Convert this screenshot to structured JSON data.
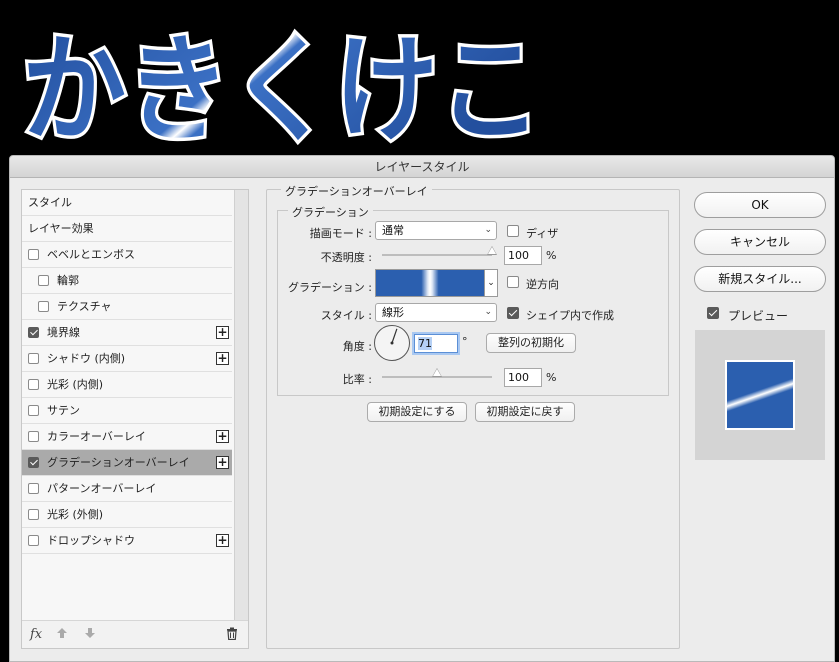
{
  "banner": {
    "text": "かきくけこ"
  },
  "dialog": {
    "title": "レイヤースタイル",
    "styles_header": "スタイル",
    "layer_effects": "レイヤー効果",
    "items": [
      {
        "label": "ベベルとエンボス",
        "checked": false,
        "plus": false
      },
      {
        "label": "輪郭",
        "checked": false,
        "plus": false
      },
      {
        "label": "テクスチャ",
        "checked": false,
        "plus": false
      },
      {
        "label": "境界線",
        "checked": true,
        "plus": true
      },
      {
        "label": "シャドウ (内側)",
        "checked": false,
        "plus": true
      },
      {
        "label": "光彩 (内側)",
        "checked": false,
        "plus": false
      },
      {
        "label": "サテン",
        "checked": false,
        "plus": false
      },
      {
        "label": "カラーオーバーレイ",
        "checked": false,
        "plus": true
      },
      {
        "label": "グラデーションオーバーレイ",
        "checked": true,
        "plus": true
      },
      {
        "label": "パターンオーバーレイ",
        "checked": false,
        "plus": false
      },
      {
        "label": "光彩 (外側)",
        "checked": false,
        "plus": false
      },
      {
        "label": "ドロップシャドウ",
        "checked": false,
        "plus": true
      }
    ],
    "footer": {
      "fx": "fx",
      "up_icon": "arrow-up-icon",
      "down_icon": "arrow-down-icon",
      "trash_icon": "trash-icon"
    }
  },
  "gradient_overlay": {
    "group_title": "グラデーションオーバーレイ",
    "subgroup_title": "グラデーション",
    "blend_mode_label": "描画モード :",
    "blend_mode_value": "通常",
    "dither_label": "ディザ",
    "dither_checked": false,
    "opacity_label": "不透明度 :",
    "opacity_value": "100",
    "opacity_unit": "%",
    "opacity_fraction": 1.0,
    "gradient_label": "グラデーション :",
    "reverse_label": "逆方向",
    "reverse_checked": false,
    "style_label": "スタイル :",
    "style_value": "線形",
    "align_label": "シェイプ内で作成",
    "align_checked": true,
    "angle_label": "角度 :",
    "angle_value": "71",
    "angle_unit": "°",
    "reset_alignment_button": "整列の初期化",
    "scale_label": "比率 :",
    "scale_value": "100",
    "scale_unit": "%",
    "scale_fraction": 0.5,
    "make_default_button": "初期設定にする",
    "reset_default_button": "初期設定に戻す"
  },
  "right": {
    "ok": "OK",
    "cancel": "キャンセル",
    "new_style": "新規スタイル...",
    "preview_label": "プレビュー",
    "preview_checked": true
  },
  "colors": {
    "gradient_blue": "#2b5faf",
    "gradient_highlight": "#ffffff",
    "banner_fill": "#2a5db0",
    "banner_outline": "#ffffff"
  }
}
